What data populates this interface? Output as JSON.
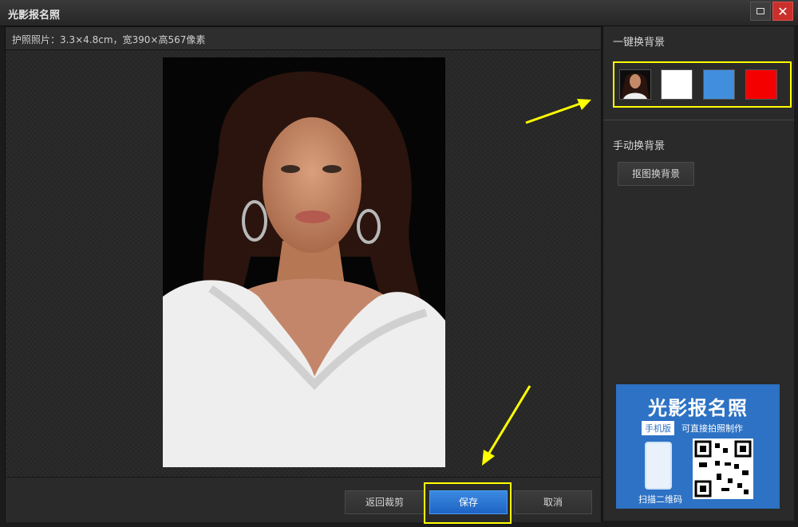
{
  "window": {
    "title": "光影报名照",
    "maximize_icon": "maximize-icon",
    "close_icon": "close-icon",
    "close_glyph": "✕"
  },
  "info_bar": {
    "text": "护照照片：3.3×4.8cm，宽390×高567像素"
  },
  "buttons": {
    "back": "返回裁剪",
    "save": "保存",
    "cancel": "取消"
  },
  "right_panel": {
    "quick_bg_title": "一键换背景",
    "swatches": [
      {
        "name": "original",
        "color": "#0c0c0c"
      },
      {
        "name": "white",
        "color": "#ffffff"
      },
      {
        "name": "blue",
        "color": "#418fdc"
      },
      {
        "name": "red",
        "color": "#f50000"
      }
    ],
    "manual_bg_title": "手动换背景",
    "cutout_button": "抠图换背景"
  },
  "ad": {
    "title": "光影报名照",
    "badge": "手机版",
    "subtitle": "可直接拍照制作",
    "scan_text": "扫描二维码"
  },
  "colors": {
    "highlight": "#ffff00",
    "accent_blue": "#2d72c4"
  }
}
